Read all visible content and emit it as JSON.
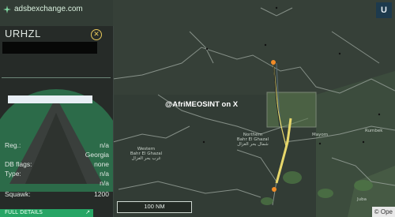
{
  "brand": {
    "name": "adsbexchange.com"
  },
  "top_right_button": {
    "label": "U"
  },
  "aircraft": {
    "callsign": "URHZL",
    "details": [
      {
        "label": "Reg.:",
        "value": "n/a"
      },
      {
        "label": "",
        "value": "Georgia"
      },
      {
        "label": "DB flags:",
        "value": "none"
      },
      {
        "label": "Type:",
        "value": "n/a"
      },
      {
        "label": "",
        "value": "n/a"
      },
      {
        "label": "Squawk:",
        "value": "1200"
      }
    ],
    "full_details_label": "FULL DETAILS"
  },
  "watermark": "@AfriMEOSINT on X",
  "scale": "100 NM",
  "attribution": "© Ope",
  "map_labels": [
    {
      "text": "Northern\nBahr El Ghazal",
      "ar": "شمال بحر الغزال"
    },
    {
      "text": "Western\nBahr El Ghazal",
      "ar": "غرب بحر الغزال"
    },
    {
      "text": "Mayom"
    },
    {
      "text": "Rumbek"
    },
    {
      "text": "Juba"
    }
  ],
  "colors": {
    "track": "#e7d76b",
    "accent": "#26a565",
    "close": "#e8c85a"
  }
}
